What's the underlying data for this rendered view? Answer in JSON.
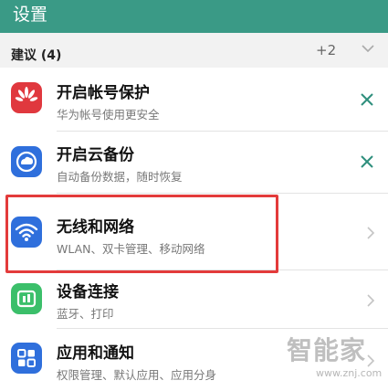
{
  "header": {
    "title": "设置"
  },
  "suggestions": {
    "title": "建议 (4)",
    "count": "+2"
  },
  "rows": [
    {
      "title": "开启帐号保护",
      "subtitle": "华为帐号使用更安全",
      "icon": "huawei-account-icon",
      "action": "close"
    },
    {
      "title": "开启云备份",
      "subtitle": "自动备份数据，随时恢复",
      "icon": "cloud-backup-icon",
      "action": "close"
    },
    {
      "title": "无线和网络",
      "subtitle": "WLAN、双卡管理、移动网络",
      "icon": "wifi-icon",
      "action": "chevron"
    },
    {
      "title": "设备连接",
      "subtitle": "蓝牙、打印",
      "icon": "device-connection-icon",
      "action": "chevron"
    },
    {
      "title": "应用和通知",
      "subtitle": "权限管理、默认应用、应用分身",
      "icon": "apps-icon",
      "action": "chevron"
    }
  ],
  "watermark": {
    "brand": "智能家",
    "url": "www.znj.com"
  },
  "colors": {
    "header_bg": "#3a9a86",
    "highlight": "#e33b3b",
    "huawei_icon": "#e0383e",
    "cloud_icon": "#2f6fdc",
    "wifi_icon": "#2f6fdc",
    "device_icon": "#3bbf6a",
    "apps_icon": "#2f6fdc"
  }
}
